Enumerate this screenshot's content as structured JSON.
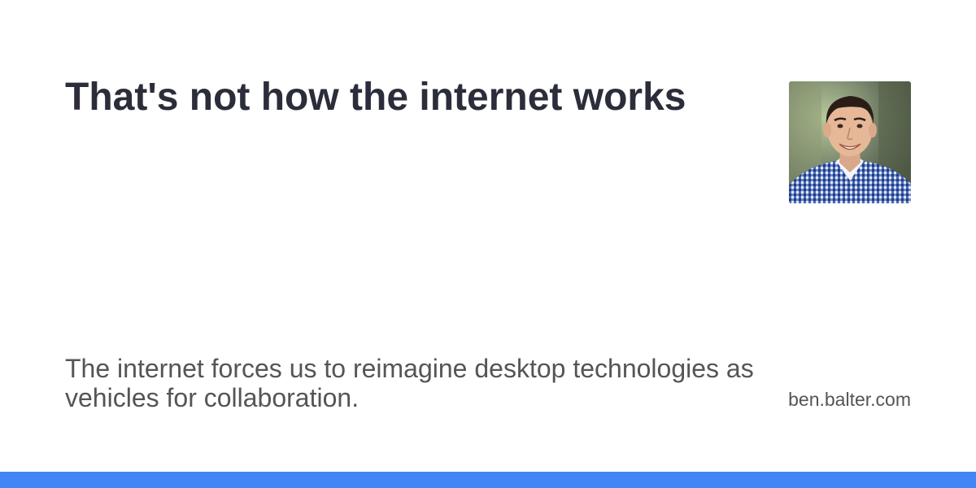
{
  "title": "That's not how the internet works",
  "description": "The internet forces us to reimagine desktop technologies as vehicles for collaboration.",
  "site_url": "ben.balter.com",
  "avatar": {
    "icon": "author-photo"
  },
  "colors": {
    "background": "#ffffff",
    "title": "#2b2d3a",
    "text": "#555555",
    "accent_bar": "#4285f4"
  }
}
